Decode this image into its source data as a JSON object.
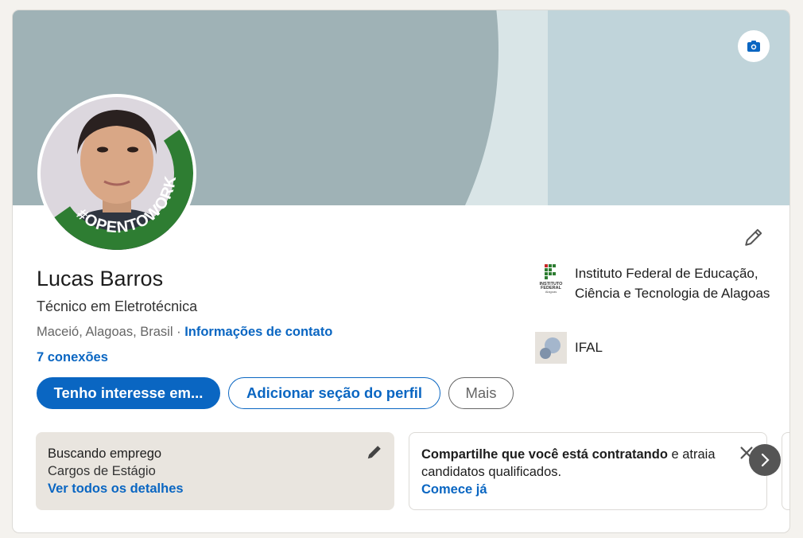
{
  "profile": {
    "name": "Lucas Barros",
    "headline": "Técnico em Eletrotécnica",
    "location": "Maceió, Alagoas, Brasil",
    "location_separator": " · ",
    "contact_link": "Informações de contato",
    "connections": "7 conexões",
    "open_to_work_badge": "#OPENTOWORK"
  },
  "actions": {
    "primary_label": "Tenho interesse em...",
    "add_section_label": "Adicionar seção do perfil",
    "more_label": "Mais"
  },
  "organizations": [
    {
      "name": "Instituto Federal de Educação, Ciência e Tecnologia de Alagoas",
      "logo_text": [
        "INSTITUTO",
        "FEDERAL",
        "Alagoas"
      ]
    },
    {
      "name": "IFAL"
    }
  ],
  "panels": {
    "jobs": {
      "title": "Buscando emprego",
      "subtitle": "Cargos de Estágio",
      "link": "Ver todos os detalhes"
    },
    "hiring": {
      "bold": "Compartilhe que você está contratando",
      "rest": " e atraia candidatos qualificados.",
      "link": "Comece já"
    }
  },
  "icons": {
    "camera": "camera-icon",
    "edit": "pencil-icon",
    "close": "close-icon",
    "next": "chevron-right-icon"
  },
  "colors": {
    "accent": "#0a66c2",
    "open_to_work_green": "#2e7d32",
    "banner_light": "#c0d4da",
    "banner_dark": "#9fb2b6"
  }
}
